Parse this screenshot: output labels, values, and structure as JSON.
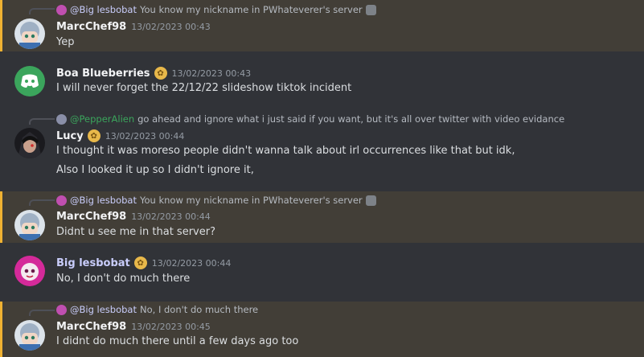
{
  "colors": {
    "background": "#313338",
    "highlight": "#423e37",
    "highlight_bar": "#f0b232",
    "pepper_mention": "#3ba55c"
  },
  "messages": [
    {
      "reply": {
        "mention": "@Big lesbobat",
        "text": "You know my nickname in PWhateverer's server"
      },
      "author": "MarcChef98",
      "timestamp": "13/02/2023 00:43",
      "lines": [
        "Yep"
      ]
    },
    {
      "author": "Boa Blueberries",
      "timestamp": "13/02/2023 00:43",
      "badge_icon": "popcorn-icon",
      "lines": [
        "I will never forget the 22/12/22 slideshow tiktok incident"
      ]
    },
    {
      "reply": {
        "mention": "@PepperAlien",
        "text": "go ahead and ignore what i just said if you want, but it's all over twitter with video evidance"
      },
      "author": "Lucy",
      "timestamp": "13/02/2023 00:44",
      "badge_icon": "popcorn-icon",
      "lines": [
        "I thought it was moreso people didn't wanna talk about irl occurrences like that but idk,",
        "Also I looked it up so I didn't ignore it,"
      ]
    },
    {
      "reply": {
        "mention": "@Big lesbobat",
        "text": "You know my nickname in PWhateverer's server"
      },
      "author": "MarcChef98",
      "timestamp": "13/02/2023 00:44",
      "lines": [
        "Didnt u see me in that server?"
      ]
    },
    {
      "author": "Big lesbobat",
      "timestamp": "13/02/2023 00:44",
      "badge_icon": "popcorn-icon",
      "lines": [
        "No, I don't do much there"
      ]
    },
    {
      "reply": {
        "mention": "@Big lesbobat",
        "text": "No, I don't do much there"
      },
      "author": "MarcChef98",
      "timestamp": "13/02/2023 00:45",
      "lines": [
        "I didnt do much there until a few days ago too"
      ]
    }
  ]
}
